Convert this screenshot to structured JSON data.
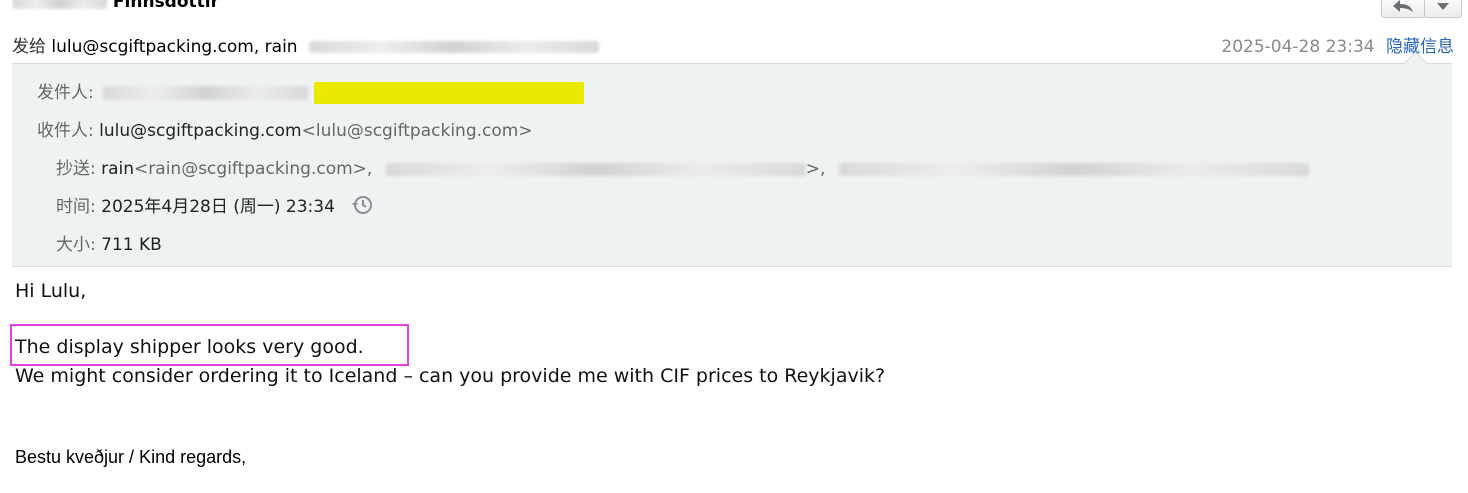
{
  "email": {
    "subject_partial": "Finnsdóttir",
    "summary": {
      "to_prefix": "发给",
      "recipients_visible": "lulu@scgiftpacking.com, rain",
      "date": "2025-04-28 23:34",
      "hide_details": "隐藏信息"
    },
    "details": {
      "from_label": "发件人:",
      "to_label": "收件人:",
      "to_name": "lulu@scgiftpacking.com",
      "to_address": "<lulu@scgiftpacking.com>",
      "cc_label": "抄送:",
      "cc_name": "rain",
      "cc_address": "<rain@scgiftpacking.com>,",
      "cc_sep": ">,",
      "time_label": "时间:",
      "time_value": "2025年4月28日 (周一) 23:34",
      "size_label": "大小:",
      "size_value": "711 KB"
    },
    "body": {
      "greeting": "Hi Lulu,",
      "line1": "The display shipper looks very good.",
      "line2": "We might consider ordering it to Iceland – can you provide me with CIF prices to Reykjavik?",
      "signoff": "Bestu kveðjur / Kind regards,"
    }
  },
  "colors": {
    "link": "#2a68b8",
    "details_bg": "#eef2f2",
    "highlight_box": "#e63fe0",
    "yellow_highlight": "#e9e900"
  },
  "icons": {
    "reply": "reply-arrow-icon",
    "more": "chevron-down-icon",
    "history": "clock-history-icon"
  }
}
